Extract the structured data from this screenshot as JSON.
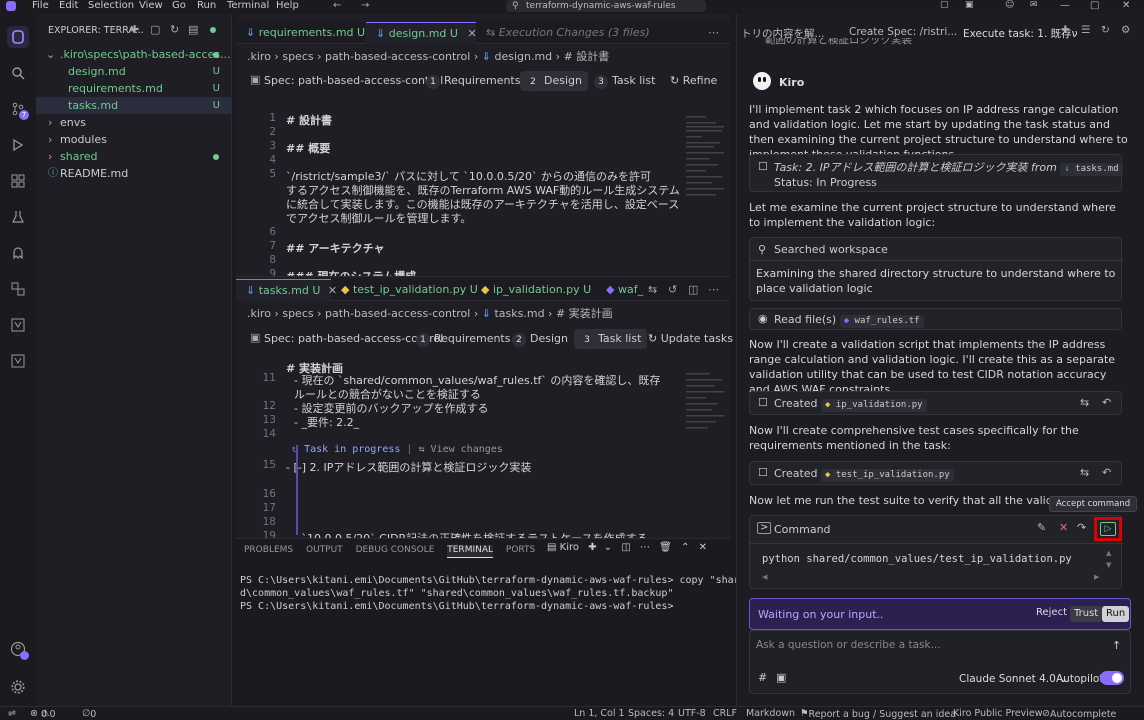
{
  "title_bar": {
    "menus": [
      "File",
      "Edit",
      "Selection",
      "View",
      "Go",
      "Run",
      "Terminal",
      "Help"
    ],
    "search": "terraform-dynamic-aws-waf-rules"
  },
  "sidebar": {
    "header": "EXPLORER: TERRA...",
    "path": ".kiro\\specs\\path-based-acces...",
    "files": [
      {
        "name": "design.md",
        "badge": "U"
      },
      {
        "name": "requirements.md",
        "badge": "U"
      },
      {
        "name": "tasks.md",
        "badge": "U"
      }
    ],
    "folders": [
      "envs",
      "modules",
      "shared"
    ],
    "readme": "README.md"
  },
  "editor_top": {
    "tabs": [
      {
        "name": "requirements.md",
        "badge": "U"
      },
      {
        "name": "design.md",
        "badge": "U"
      },
      {
        "name": "Execution Changes (3 files)"
      }
    ],
    "breadcrumb": [
      ".kiro",
      "specs",
      "path-based-access-control",
      "design.md",
      "# 設計書"
    ],
    "spec_label": "Spec: path-based-access-control",
    "steps": [
      {
        "n": "1",
        "label": "Requirements"
      },
      {
        "n": "2",
        "label": "Design"
      },
      {
        "n": "3",
        "label": "Task list"
      }
    ],
    "refine": "Refine",
    "lines": [
      {
        "n": "1",
        "text": "# 設計書"
      },
      {
        "n": "2",
        "text": ""
      },
      {
        "n": "3",
        "text": "## 概要"
      },
      {
        "n": "4",
        "text": ""
      },
      {
        "n": "5",
        "text": "`/ristrict/sample3/` パスに対して `10.0.0.5/20` からの通信のみを許可"
      },
      {
        "n": "",
        "text": "するアクセス制御機能を、既存のTerraform AWS WAF動的ルール生成システム"
      },
      {
        "n": "",
        "text": "に統合して実装します。この機能は既存のアーキテクチャを活用し、設定ベース"
      },
      {
        "n": "",
        "text": "でアクセス制御ルールを管理します。"
      },
      {
        "n": "6",
        "text": ""
      },
      {
        "n": "7",
        "text": "## アーキテクチャ"
      },
      {
        "n": "8",
        "text": ""
      },
      {
        "n": "9",
        "text": "### 現在のシステム構成"
      }
    ]
  },
  "editor_bottom": {
    "tabs": [
      {
        "name": "tasks.md",
        "badge": "U"
      },
      {
        "name": "test_ip_validation.py",
        "badge": "U"
      },
      {
        "name": "ip_validation.py",
        "badge": "U"
      },
      {
        "name": "waf_"
      }
    ],
    "breadcrumb": [
      ".kiro",
      "specs",
      "path-based-access-control",
      "tasks.md",
      "# 実装計画"
    ],
    "spec_label": "Spec: path-based-access-control",
    "steps": [
      {
        "n": "1",
        "label": "Requirements"
      },
      {
        "n": "2",
        "label": "Design"
      },
      {
        "n": "3",
        "label": "Task list"
      }
    ],
    "update": "Update tasks",
    "sticky": "# 実装計画",
    "lines": [
      {
        "n": "11",
        "text": "  - 現在の `shared/common_values/waf_rules.tf` の内容を確認し、既存"
      },
      {
        "n": "",
        "text": "  ルールとの競合がないことを検証する"
      },
      {
        "n": "12",
        "text": "  - 設定変更前のバックアップを作成する"
      },
      {
        "n": "13",
        "text": "  - _要件: 2.2_"
      },
      {
        "n": "14",
        "text": ""
      }
    ],
    "codelens_progress": "Task in progress",
    "codelens_sep": "|",
    "codelens_changes": "View changes",
    "task_line": {
      "n": "15",
      "text": "- [-] 2. IPアドレス範囲の計算と検証ロジック実装"
    },
    "lines2": [
      {
        "n": "16",
        "text": ""
      },
      {
        "n": "17",
        "text": ""
      },
      {
        "n": "18",
        "text": ""
      },
      {
        "n": "19",
        "text": "  - `10.0.0.5/20` CIDR記法の正確性を検証するテストケースを作成する"
      }
    ]
  },
  "panel": {
    "tabs": [
      "PROBLEMS",
      "OUTPUT",
      "DEBUG CONSOLE",
      "TERMINAL",
      "PORTS"
    ],
    "terminal_name": "Kiro",
    "lines": [
      "PS C:\\Users\\kitani.emi\\Documents\\GitHub\\terraform-dynamic-aws-waf-rules> copy \"share",
      "d\\common_values\\waf_rules.tf\" \"shared\\common_values\\waf_rules.tf.backup\"",
      "PS C:\\Users\\kitani.emi\\Documents\\GitHub\\terraform-dynamic-aws-waf-rules>"
    ]
  },
  "chat": {
    "tabs": [
      "トリの内容を解...",
      "Create Spec: /ristri...",
      "Execute task: 1. 既存ν"
    ],
    "top_text": "範囲の計算と検証ロジック実装",
    "author": "Kiro",
    "msg1": "I'll implement task 2 which focuses on IP address range calculation and validation logic. Let me start by updating the task status and then examining the current project structure to understand where to implement these validation functions.",
    "task_card_prefix": "Task: 2. IPアドレス範囲の計算と検証ロジック実装 from",
    "task_card_file": "tasks.md",
    "task_card_status": "Status: In Progress",
    "msg2": "Let me examine the current project structure to understand where to implement the validation logic:",
    "search_label": "Searched workspace",
    "search_desc": "Examining the shared directory structure to understand where to place validation logic",
    "read_label": "Read file(s)",
    "read_file": "waf_rules.tf",
    "msg3": "Now I'll create a validation script that implements the IP address range calculation and validation logic. I'll create this as a separate validation utility that can be used to test CIDR notation accuracy and AWS WAF constraints.",
    "created1_label": "Created",
    "created1_file": "ip_validation.py",
    "msg4": "Now I'll create comprehensive test cases specifically for the requirements mentioned in the task:",
    "created2_label": "Created",
    "created2_file": "test_ip_validation.py",
    "msg5": "Now let me run the test suite to verify that all the validation logic wo",
    "tooltip": "Accept command",
    "command_label": "Command",
    "command_text": "python shared/common_values/test_ip_validation.py",
    "waiting": "Waiting on your input..",
    "reject": "Reject",
    "trust": "Trust",
    "run": "Run",
    "input_placeholder": "Ask a question or describe a task...",
    "model": "Claude Sonnet 4.0",
    "autopilot": "Autopilot"
  },
  "status_bar": {
    "errors": "0",
    "warnings": "0",
    "ports": "0",
    "position": "Ln 1, Col 1",
    "spaces": "Spaces: 4",
    "encoding": "UTF-8",
    "eol": "CRLF",
    "language": "Markdown",
    "report": "Report a bug / Suggest an idea",
    "preview": "Kiro Public Preview",
    "autocomplete": "Autocomplete"
  },
  "colors": {
    "accent": "#8a6cff",
    "highlight": "#e00000",
    "added": "#73c991",
    "link": "#c586c0"
  }
}
